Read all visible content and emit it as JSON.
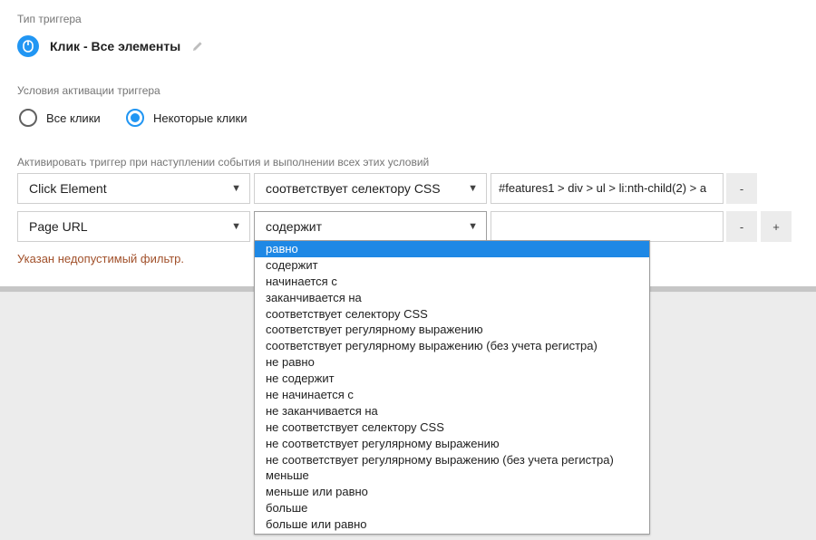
{
  "trigger_type": {
    "label": "Тип триггера",
    "name": "Клик - Все элементы",
    "icon": "mouse-icon",
    "edit_icon": "pencil-icon"
  },
  "activation": {
    "label": "Условия активации триггера",
    "options": [
      {
        "label": "Все клики",
        "checked": false
      },
      {
        "label": "Некоторые клики",
        "checked": true
      }
    ]
  },
  "conditions": {
    "label": "Активировать триггер при наступлении события и выполнении всех этих условий",
    "rows": [
      {
        "variable": "Click Element",
        "operator": "соответствует селектору CSS",
        "value": "#features1 > div > ul > li:nth-child(2) > a",
        "remove_label": "-"
      },
      {
        "variable": "Page URL",
        "operator": "содержит",
        "value": "",
        "remove_label": "-",
        "add_label": "+"
      }
    ],
    "error": "Указан недопустимый фильтр."
  },
  "operator_dropdown": {
    "highlighted": "равно",
    "options": [
      "равно",
      "содержит",
      "начинается с",
      "заканчивается на",
      "соответствует селектору CSS",
      "соответствует регулярному выражению",
      "соответствует регулярному выражению (без учета регистра)",
      "не равно",
      "не содержит",
      "не начинается с",
      "не заканчивается на",
      "не соответствует селектору CSS",
      "не соответствует регулярному выражению",
      "не соответствует регулярному выражению (без учета регистра)",
      "меньше",
      "меньше или равно",
      "больше",
      "больше или равно"
    ]
  },
  "colors": {
    "accent": "#2196f3",
    "highlight": "#1e88e5",
    "error": "#a1502a"
  }
}
